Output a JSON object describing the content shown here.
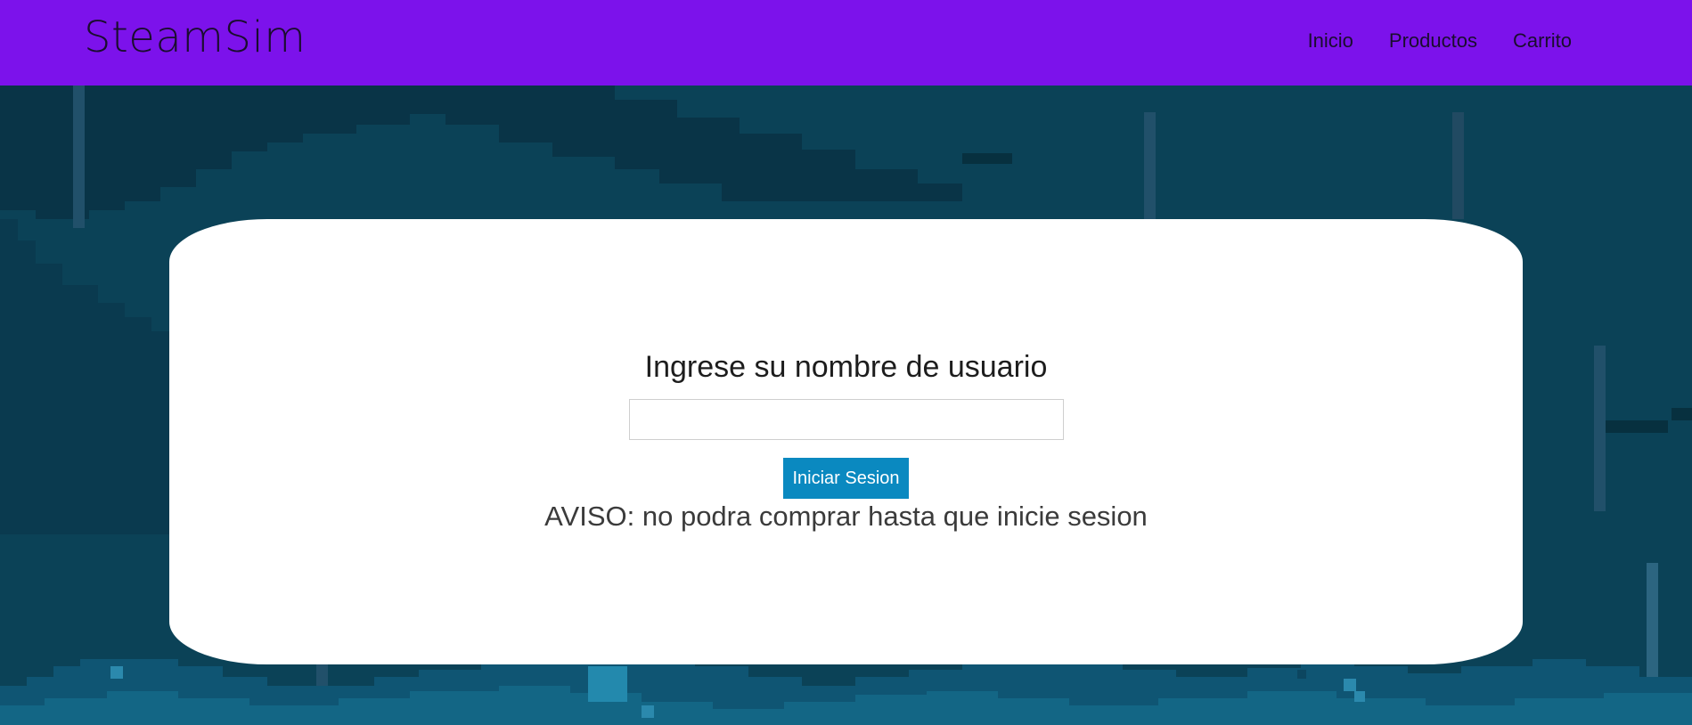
{
  "navbar": {
    "brand": "SteamSim",
    "links": [
      {
        "label": "Inicio"
      },
      {
        "label": "Productos"
      },
      {
        "label": "Carrito"
      }
    ]
  },
  "login": {
    "heading": "Ingrese su nombre de usuario",
    "username_value": "",
    "submit_label": "Iniciar Sesion",
    "notice": "AVISO: no podra comprar hasta que inicie sesion"
  },
  "colors": {
    "navbar": "#7c12eb",
    "button": "#0a89c0",
    "background": "#0b4257",
    "card": "#ffffff"
  }
}
